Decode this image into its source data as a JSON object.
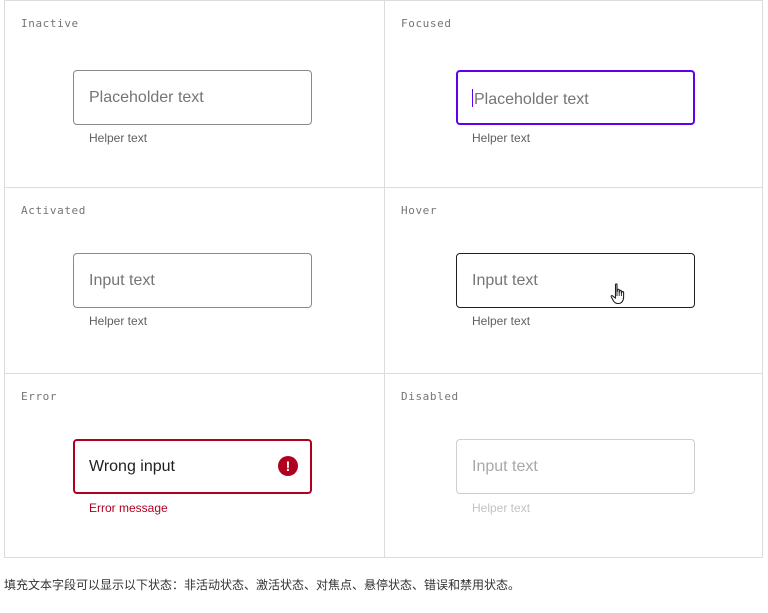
{
  "states": {
    "inactive": {
      "label": "Inactive",
      "field_text": "Placeholder text",
      "helper": "Helper text"
    },
    "focused": {
      "label": "Focused",
      "field_text": "Placeholder text",
      "helper": "Helper text"
    },
    "activated": {
      "label": "Activated",
      "field_text": "Input text",
      "helper": "Helper text"
    },
    "hover": {
      "label": "Hover",
      "field_text": "Input text",
      "helper": "Helper text"
    },
    "error": {
      "label": "Error",
      "field_text": "Wrong input",
      "helper": "Error message",
      "icon": "!"
    },
    "disabled": {
      "label": "Disabled",
      "field_text": "Input text",
      "helper": "Helper text"
    }
  },
  "caption": "填充文本字段可以显示以下状态：非活动状态、激活状态、对焦点、悬停状态、错误和禁用状态。",
  "colors": {
    "focus": "#6200ee",
    "error": "#b00020",
    "border": "#8a8a8a",
    "disabled": "#cfcfcf"
  },
  "icons": {
    "error": "error-icon",
    "cursor": "hand-pointer-icon"
  }
}
